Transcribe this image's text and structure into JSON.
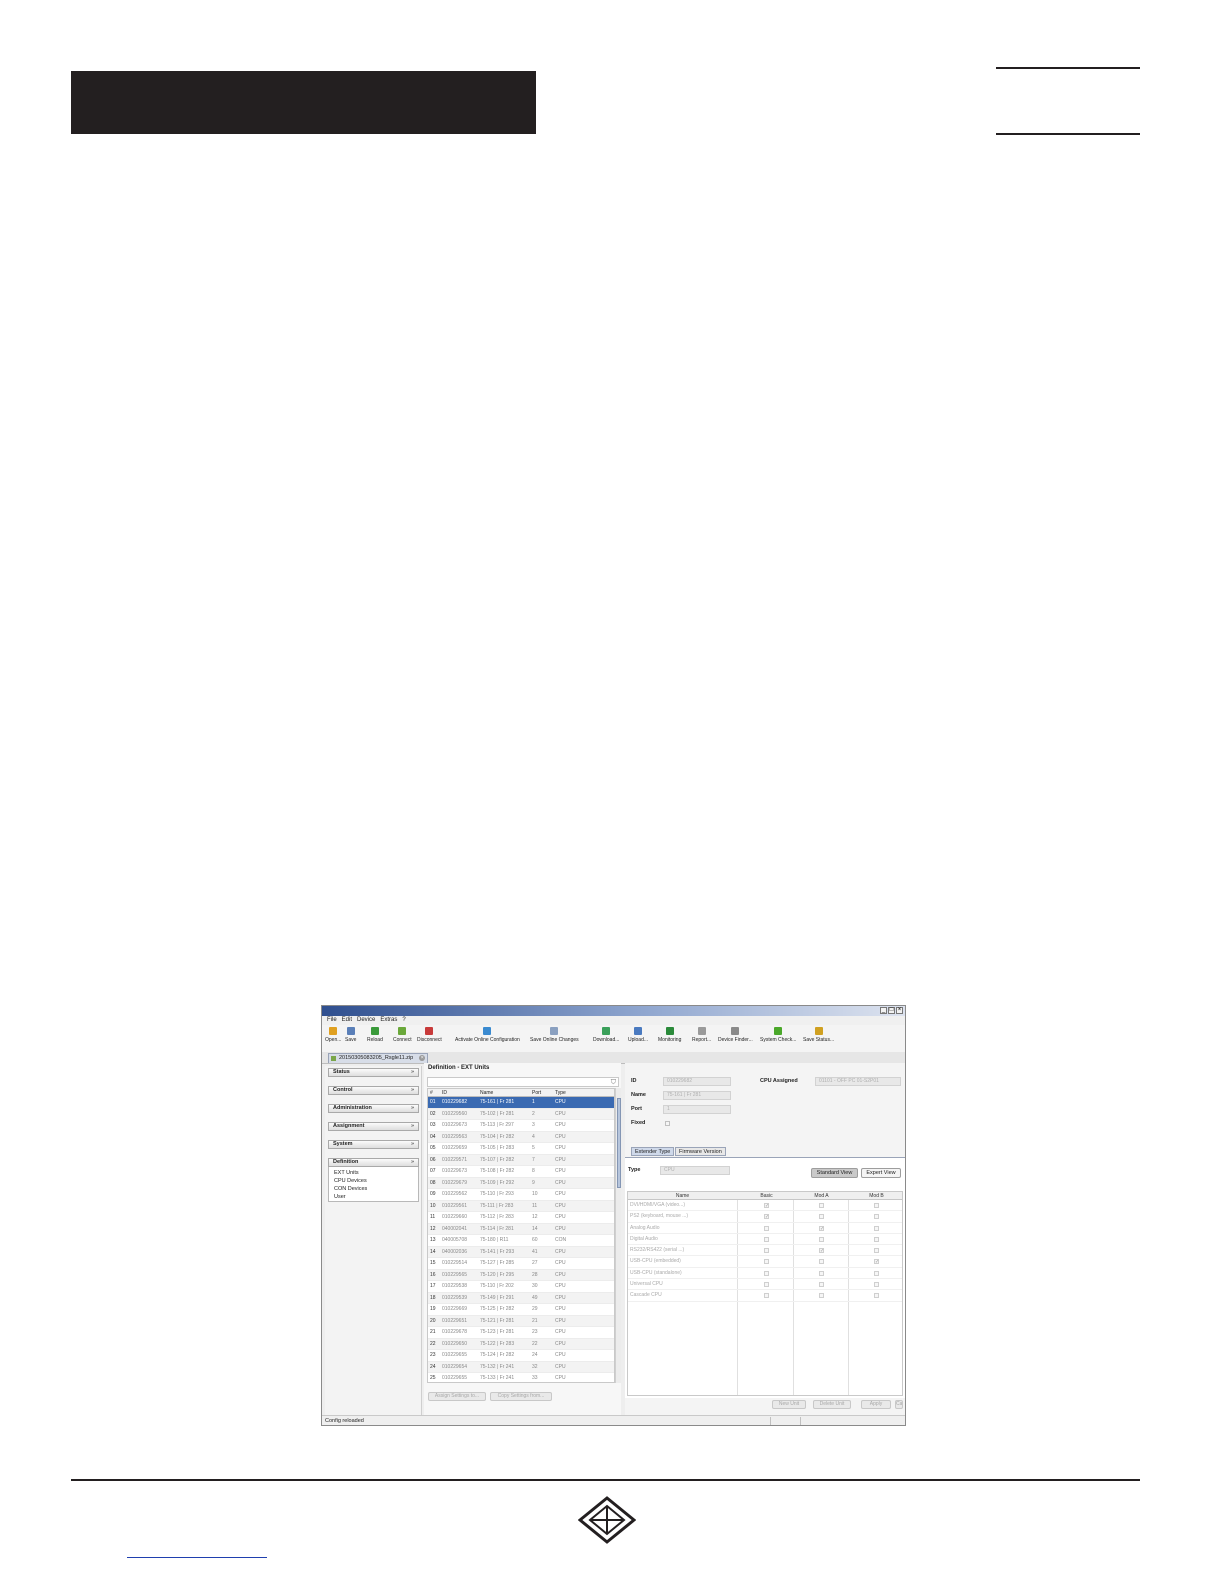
{
  "menu": [
    "File",
    "Edit",
    "Device",
    "Extras",
    "?"
  ],
  "window_controls": [
    "_",
    "□",
    "×"
  ],
  "toolbar": [
    {
      "label": "Open...",
      "icon": "folder-open-icon",
      "color": "#e0a020"
    },
    {
      "label": "Save",
      "icon": "save-icon",
      "color": "#5a7fb8"
    },
    {
      "label": "Reload",
      "icon": "reload-icon",
      "color": "#3a9a3a"
    },
    {
      "label": "Connect",
      "icon": "connect-icon",
      "color": "#6aa83a"
    },
    {
      "label": "Disconnect",
      "icon": "disconnect-icon",
      "color": "#c83a3a"
    },
    {
      "label": "Activate Online Configuration",
      "icon": "activate-icon",
      "color": "#3a8ad0"
    },
    {
      "label": "Save Online Changes",
      "icon": "save-online-icon",
      "color": "#8aa0c0"
    },
    {
      "label": "Download...",
      "icon": "download-icon",
      "color": "#3aa05a"
    },
    {
      "label": "Upload...",
      "icon": "upload-icon",
      "color": "#4a7ac0"
    },
    {
      "label": "Monitoring",
      "icon": "monitoring-icon",
      "color": "#2a8a3a"
    },
    {
      "label": "Report...",
      "icon": "report-icon",
      "color": "#9a9a9a"
    },
    {
      "label": "Device Finder...",
      "icon": "device-finder-icon",
      "color": "#8a8a8a"
    },
    {
      "label": "System Check...",
      "icon": "check-icon",
      "color": "#4aa82a"
    },
    {
      "label": "Save Status...",
      "icon": "save-status-icon",
      "color": "#d0a020"
    }
  ],
  "file_tab": "20150305083205_Rsgle11.zip",
  "nav": {
    "sections": [
      "Status",
      "Control",
      "Administration",
      "Assignment",
      "System",
      "Definition"
    ],
    "definition_items": [
      "EXT Units",
      "CPU Devices",
      "CON Devices",
      "User"
    ]
  },
  "center": {
    "title": "Definition - EXT Units",
    "columns": [
      "#",
      "ID",
      "Name",
      "Port",
      "Type"
    ],
    "rows": [
      [
        "01",
        "010229682",
        "75-161 | Fr 281",
        "1",
        "CPU"
      ],
      [
        "02",
        "010229560",
        "75-102 | Fr 281",
        "2",
        "CPU"
      ],
      [
        "03",
        "010229673",
        "75-113 | Fr 297",
        "3",
        "CPU"
      ],
      [
        "04",
        "010229563",
        "75-104 | Fr 282",
        "4",
        "CPU"
      ],
      [
        "05",
        "010229659",
        "75-105 | Fr 283",
        "5",
        "CPU"
      ],
      [
        "06",
        "010229571",
        "75-107 | Fr 282",
        "7",
        "CPU"
      ],
      [
        "07",
        "010229673",
        "75-108 | Fr 282",
        "8",
        "CPU"
      ],
      [
        "08",
        "010229679",
        "75-109 | Fr 292",
        "9",
        "CPU"
      ],
      [
        "09",
        "010229562",
        "75-110 | Fr 293",
        "10",
        "CPU"
      ],
      [
        "10",
        "010229561",
        "75-111 | Fr 283",
        "11",
        "CPU"
      ],
      [
        "11",
        "010229660",
        "75-112 | Fr 283",
        "12",
        "CPU"
      ],
      [
        "12",
        "040002041",
        "75-114 | Fr 281",
        "14",
        "CPU"
      ],
      [
        "13",
        "040005708",
        "75-180 | R11",
        "60",
        "CON"
      ],
      [
        "14",
        "040002036",
        "75-141 | Fr 293",
        "41",
        "CPU"
      ],
      [
        "15",
        "010229514",
        "75-127 | Fr 285",
        "27",
        "CPU"
      ],
      [
        "16",
        "010229565",
        "75-120 | Fr 295",
        "28",
        "CPU"
      ],
      [
        "17",
        "010229538",
        "75-110 | Fr 202",
        "30",
        "CPU"
      ],
      [
        "18",
        "010229539",
        "75-149 | Fr 291",
        "49",
        "CPU"
      ],
      [
        "19",
        "010229669",
        "75-125 | Fr 282",
        "29",
        "CPU"
      ],
      [
        "20",
        "010229651",
        "75-121 | Fr 281",
        "21",
        "CPU"
      ],
      [
        "21",
        "010229678",
        "75-123 | Fr 281",
        "23",
        "CPU"
      ],
      [
        "22",
        "010229650",
        "75-122 | Fr 283",
        "22",
        "CPU"
      ],
      [
        "23",
        "010229655",
        "75-124 | Fr 282",
        "24",
        "CPU"
      ],
      [
        "24",
        "010229654",
        "75-132 | Fr 241",
        "32",
        "CPU"
      ],
      [
        "25",
        "010229655",
        "75-133 | Fr 241",
        "33",
        "CPU"
      ]
    ],
    "buttons": [
      "Assign Settings to...",
      "Copy Settings from..."
    ]
  },
  "detail": {
    "labels": {
      "id": "ID",
      "name": "Name",
      "port": "Port",
      "fixed": "Fixed",
      "cpu_assigned": "CPU Assigned",
      "type": "Type"
    },
    "values": {
      "id": "010229682",
      "name": "75-161 | Fr 281",
      "port": "1",
      "cpu_assigned": "01101 - OFF PC 01-S2P01",
      "type": "CPU"
    },
    "tabs": [
      "Extender Type",
      "Firmware Version"
    ],
    "view_buttons": [
      "Standard View",
      "Expert View"
    ],
    "feature_columns": [
      "Name",
      "Basic",
      "Mod A",
      "Mod B"
    ],
    "features": [
      {
        "name": "DVI/HDMI/VGA (video...)",
        "checks": [
          true,
          false,
          false
        ]
      },
      {
        "name": "PS2 (keyboard, mouse ...)",
        "checks": [
          true,
          false,
          false
        ]
      },
      {
        "name": "Analog Audio",
        "checks": [
          false,
          true,
          false
        ]
      },
      {
        "name": "Digital Audio",
        "checks": [
          false,
          false,
          false
        ]
      },
      {
        "name": "RS232/RS422 (serial ...)",
        "checks": [
          false,
          true,
          false
        ]
      },
      {
        "name": "USB-CPU (embedded)",
        "checks": [
          false,
          false,
          true
        ]
      },
      {
        "name": "USB-CPU (standalone)",
        "checks": [
          false,
          false,
          false
        ]
      },
      {
        "name": "Universal CPU",
        "checks": [
          false,
          false,
          false
        ]
      },
      {
        "name": "Cascade CPU",
        "checks": [
          false,
          false,
          false
        ]
      }
    ],
    "bottom_buttons": [
      "New Unit",
      "Delete Unit",
      "Apply",
      "Cancel"
    ]
  },
  "status_text": "Config reloaded"
}
